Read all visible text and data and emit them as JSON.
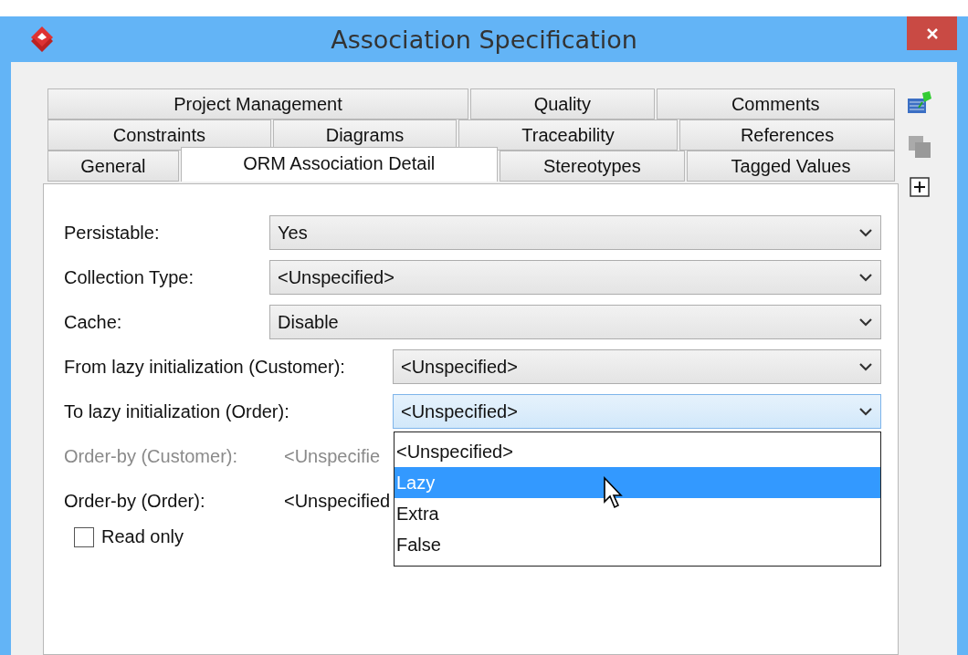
{
  "window": {
    "title": "Association Specification"
  },
  "tab_rows": [
    [
      {
        "label": "Project Management",
        "selected": false
      },
      {
        "label": "Quality",
        "selected": false
      },
      {
        "label": "Comments",
        "selected": false
      }
    ],
    [
      {
        "label": "Constraints",
        "selected": false
      },
      {
        "label": "Diagrams",
        "selected": false
      },
      {
        "label": "Traceability",
        "selected": false
      },
      {
        "label": "References",
        "selected": false
      }
    ],
    [
      {
        "label": "General",
        "selected": false
      },
      {
        "label": "ORM Association Detail",
        "selected": true
      },
      {
        "label": "Stereotypes",
        "selected": false
      },
      {
        "label": "Tagged Values",
        "selected": false
      }
    ]
  ],
  "fields": [
    {
      "kind": "combo",
      "label": "Persistable:",
      "value": "Yes",
      "focused": false
    },
    {
      "kind": "combo",
      "label": "Collection Type:",
      "value": "<Unspecified>",
      "focused": false
    },
    {
      "kind": "combo",
      "label": "Cache:",
      "value": "Disable",
      "focused": false
    },
    {
      "kind": "combo-wide",
      "label": "From lazy initialization (Customer):",
      "value": "<Unspecified>",
      "focused": false
    },
    {
      "kind": "combo-wide",
      "label": "To lazy initialization (Order):",
      "value": "<Unspecified>",
      "focused": true
    },
    {
      "kind": "text",
      "label": "Order-by (Customer):",
      "value": "<Unspecifie",
      "disabled": true
    },
    {
      "kind": "text",
      "label": "Order-by (Order):",
      "value": "<Unspecified",
      "disabled": false
    }
  ],
  "dropdown": {
    "items": [
      {
        "label": "<Unspecified>",
        "selected": false
      },
      {
        "label": "Lazy",
        "selected": true
      },
      {
        "label": "Extra",
        "selected": false
      },
      {
        "label": "False",
        "selected": false
      }
    ]
  },
  "read_only": {
    "label": "Read only",
    "checked": false
  }
}
